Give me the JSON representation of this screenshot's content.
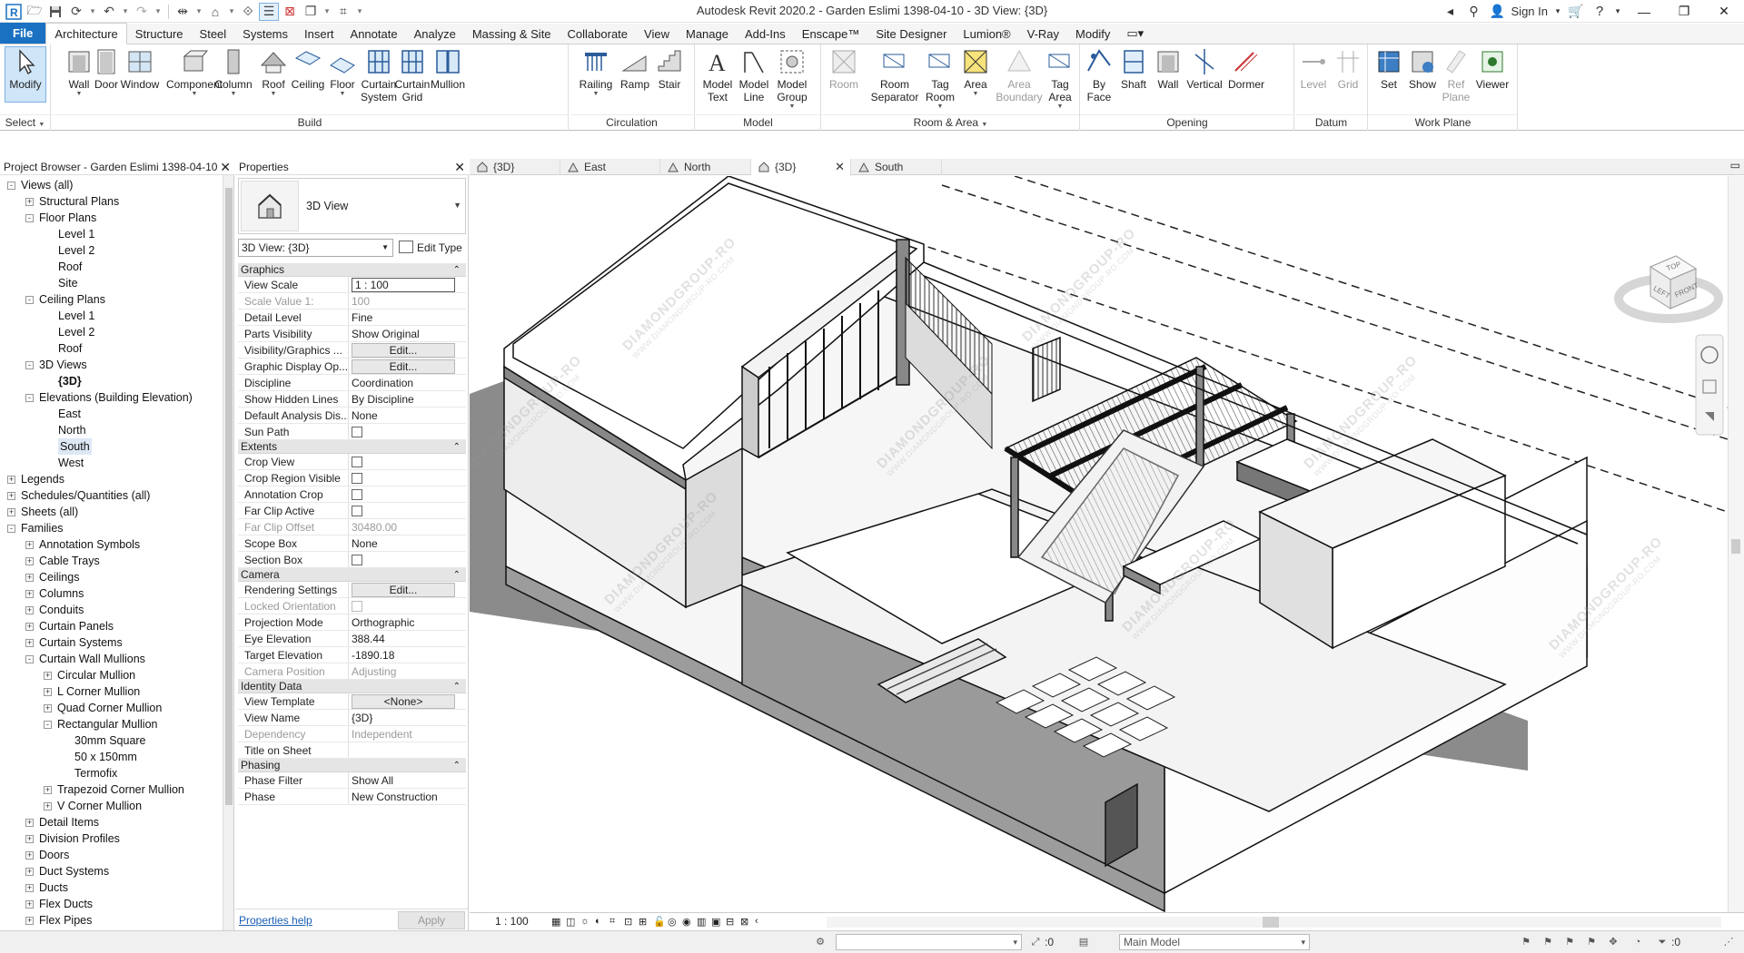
{
  "window": {
    "title": "Autodesk Revit 2020.2 - Garden Eslimi 1398-04-10 - 3D View: {3D}",
    "sign_in": "Sign In"
  },
  "ribbon_tabs": [
    {
      "label": "File",
      "kind": "file"
    },
    {
      "label": "Architecture",
      "kind": "active"
    },
    {
      "label": "Structure"
    },
    {
      "label": "Steel"
    },
    {
      "label": "Systems"
    },
    {
      "label": "Insert"
    },
    {
      "label": "Annotate"
    },
    {
      "label": "Analyze"
    },
    {
      "label": "Massing & Site"
    },
    {
      "label": "Collaborate"
    },
    {
      "label": "View"
    },
    {
      "label": "Manage"
    },
    {
      "label": "Add-Ins"
    },
    {
      "label": "Enscape™"
    },
    {
      "label": "Site Designer"
    },
    {
      "label": "Lumion®"
    },
    {
      "label": "V-Ray"
    },
    {
      "label": "Modify"
    }
  ],
  "ribbon_groups": {
    "select": {
      "label": "Select",
      "buttons": [
        {
          "label": "Modify"
        }
      ]
    },
    "build": {
      "label": "Build",
      "buttons": [
        {
          "label": "Wall"
        },
        {
          "label": "Door"
        },
        {
          "label": "Window"
        },
        {
          "label": "Component"
        },
        {
          "label": "Column"
        },
        {
          "label": "Roof"
        },
        {
          "label": "Ceiling"
        },
        {
          "label": "Floor"
        },
        {
          "label": "Curtain\nSystem"
        },
        {
          "label": "Curtain\nGrid"
        },
        {
          "label": "Mullion"
        }
      ]
    },
    "circulation": {
      "label": "Circulation",
      "buttons": [
        {
          "label": "Railing"
        },
        {
          "label": "Ramp"
        },
        {
          "label": "Stair"
        }
      ]
    },
    "model": {
      "label": "Model",
      "buttons": [
        {
          "label": "Model\nText"
        },
        {
          "label": "Model\nLine"
        },
        {
          "label": "Model\nGroup"
        }
      ]
    },
    "room_area": {
      "label": "Room & Area",
      "buttons": [
        {
          "label": "Room"
        },
        {
          "label": "Room\nSeparator"
        },
        {
          "label": "Tag\nRoom"
        },
        {
          "label": "Area"
        },
        {
          "label": "Area\nBoundary"
        },
        {
          "label": "Tag\nArea"
        }
      ]
    },
    "opening": {
      "label": "Opening",
      "buttons": [
        {
          "label": "By\nFace"
        },
        {
          "label": "Shaft"
        },
        {
          "label": "Wall"
        },
        {
          "label": "Vertical"
        },
        {
          "label": "Dormer"
        }
      ]
    },
    "datum": {
      "label": "Datum",
      "buttons": [
        {
          "label": "Level"
        },
        {
          "label": "Grid"
        }
      ]
    },
    "work_plane": {
      "label": "Work Plane",
      "buttons": [
        {
          "label": "Set"
        },
        {
          "label": "Show"
        },
        {
          "label": "Ref\nPlane"
        },
        {
          "label": "Viewer"
        }
      ]
    }
  },
  "project_browser": {
    "title": "Project Browser - Garden Eslimi 1398-04-10",
    "items": [
      {
        "label": "Views (all)",
        "level": 0,
        "toggle": "-"
      },
      {
        "label": "Structural Plans",
        "level": 1,
        "toggle": "+"
      },
      {
        "label": "Floor Plans",
        "level": 1,
        "toggle": "-"
      },
      {
        "label": "Level 1",
        "level": 2
      },
      {
        "label": "Level 2",
        "level": 2
      },
      {
        "label": "Roof",
        "level": 2
      },
      {
        "label": "Site",
        "level": 2
      },
      {
        "label": "Ceiling Plans",
        "level": 1,
        "toggle": "-"
      },
      {
        "label": "Level 1",
        "level": 2
      },
      {
        "label": "Level 2",
        "level": 2
      },
      {
        "label": "Roof",
        "level": 2
      },
      {
        "label": "3D Views",
        "level": 1,
        "toggle": "-"
      },
      {
        "label": "{3D}",
        "level": 2,
        "bold": true
      },
      {
        "label": "Elevations (Building Elevation)",
        "level": 1,
        "toggle": "-"
      },
      {
        "label": "East",
        "level": 2
      },
      {
        "label": "North",
        "level": 2
      },
      {
        "label": "South",
        "level": 2,
        "selected": true
      },
      {
        "label": "West",
        "level": 2
      },
      {
        "label": "Legends",
        "level": 0,
        "toggle": "+"
      },
      {
        "label": "Schedules/Quantities (all)",
        "level": 0,
        "toggle": "+"
      },
      {
        "label": "Sheets (all)",
        "level": 0,
        "toggle": "+"
      },
      {
        "label": "Families",
        "level": 0,
        "toggle": "-"
      },
      {
        "label": "Annotation Symbols",
        "level": 1,
        "toggle": "+"
      },
      {
        "label": "Cable Trays",
        "level": 1,
        "toggle": "+"
      },
      {
        "label": "Ceilings",
        "level": 1,
        "toggle": "+"
      },
      {
        "label": "Columns",
        "level": 1,
        "toggle": "+"
      },
      {
        "label": "Conduits",
        "level": 1,
        "toggle": "+"
      },
      {
        "label": "Curtain Panels",
        "level": 1,
        "toggle": "+"
      },
      {
        "label": "Curtain Systems",
        "level": 1,
        "toggle": "+"
      },
      {
        "label": "Curtain Wall Mullions",
        "level": 1,
        "toggle": "-"
      },
      {
        "label": "Circular Mullion",
        "level": 2,
        "toggle": "+"
      },
      {
        "label": "L Corner Mullion",
        "level": 2,
        "toggle": "+"
      },
      {
        "label": "Quad Corner Mullion",
        "level": 2,
        "toggle": "+"
      },
      {
        "label": "Rectangular Mullion",
        "level": 2,
        "toggle": "-"
      },
      {
        "label": "30mm Square",
        "level": 3
      },
      {
        "label": "50 x 150mm",
        "level": 3
      },
      {
        "label": "Termofix",
        "level": 3
      },
      {
        "label": "Trapezoid Corner Mullion",
        "level": 2,
        "toggle": "+"
      },
      {
        "label": "V Corner Mullion",
        "level": 2,
        "toggle": "+"
      },
      {
        "label": "Detail Items",
        "level": 1,
        "toggle": "+"
      },
      {
        "label": "Division Profiles",
        "level": 1,
        "toggle": "+"
      },
      {
        "label": "Doors",
        "level": 1,
        "toggle": "+"
      },
      {
        "label": "Duct Systems",
        "level": 1,
        "toggle": "+"
      },
      {
        "label": "Ducts",
        "level": 1,
        "toggle": "+"
      },
      {
        "label": "Flex Ducts",
        "level": 1,
        "toggle": "+"
      },
      {
        "label": "Flex Pipes",
        "level": 1,
        "toggle": "+"
      }
    ]
  },
  "properties": {
    "title": "Properties",
    "type_name": "3D View",
    "instance_selector": "3D View: {3D}",
    "edit_type": "Edit Type",
    "help_link": "Properties help",
    "apply": "Apply",
    "categories": [
      {
        "name": "Graphics",
        "rows": [
          {
            "name": "View Scale",
            "value": "1 : 100",
            "kind": "input"
          },
          {
            "name": "Scale Value    1:",
            "value": "100",
            "dim": true
          },
          {
            "name": "Detail Level",
            "value": "Fine"
          },
          {
            "name": "Parts Visibility",
            "value": "Show Original"
          },
          {
            "name": "Visibility/Graphics ...",
            "value": "Edit...",
            "kind": "button"
          },
          {
            "name": "Graphic Display Op...",
            "value": "Edit...",
            "kind": "button"
          },
          {
            "name": "Discipline",
            "value": "Coordination"
          },
          {
            "name": "Show Hidden Lines",
            "value": "By Discipline"
          },
          {
            "name": "Default Analysis Dis...",
            "value": "None"
          },
          {
            "name": "Sun Path",
            "value": "",
            "kind": "check"
          }
        ]
      },
      {
        "name": "Extents",
        "rows": [
          {
            "name": "Crop View",
            "value": "",
            "kind": "check"
          },
          {
            "name": "Crop Region Visible",
            "value": "",
            "kind": "check"
          },
          {
            "name": "Annotation Crop",
            "value": "",
            "kind": "check"
          },
          {
            "name": "Far Clip Active",
            "value": "",
            "kind": "check"
          },
          {
            "name": "Far Clip Offset",
            "value": "30480.00",
            "dim": true
          },
          {
            "name": "Scope Box",
            "value": "None"
          },
          {
            "name": "Section Box",
            "value": "",
            "kind": "check"
          }
        ]
      },
      {
        "name": "Camera",
        "rows": [
          {
            "name": "Rendering Settings",
            "value": "Edit...",
            "kind": "button"
          },
          {
            "name": "Locked Orientation",
            "value": "",
            "kind": "check",
            "dim": true
          },
          {
            "name": "Projection Mode",
            "value": "Orthographic"
          },
          {
            "name": "Eye Elevation",
            "value": "388.44"
          },
          {
            "name": "Target Elevation",
            "value": "-1890.18"
          },
          {
            "name": "Camera Position",
            "value": "Adjusting",
            "dim": true
          }
        ]
      },
      {
        "name": "Identity Data",
        "rows": [
          {
            "name": "View Template",
            "value": "<None>",
            "kind": "button"
          },
          {
            "name": "View Name",
            "value": "{3D}"
          },
          {
            "name": "Dependency",
            "value": "Independent",
            "dim": true
          },
          {
            "name": "Title on Sheet",
            "value": ""
          }
        ]
      },
      {
        "name": "Phasing",
        "rows": [
          {
            "name": "Phase Filter",
            "value": "Show All"
          },
          {
            "name": "Phase",
            "value": "New Construction"
          }
        ]
      }
    ]
  },
  "view_tabs": [
    {
      "label": "{3D}"
    },
    {
      "label": "East"
    },
    {
      "label": "North"
    },
    {
      "label": "{3D}",
      "active": true
    },
    {
      "label": "South"
    }
  ],
  "view_control_bar": {
    "scale": "1 : 100"
  },
  "viewcube": {
    "top": "TOP",
    "left": "LEFT",
    "front": "FRONT"
  },
  "watermark": {
    "name": "DIAMONDGROUP-RO",
    "url": "WWW.DIAMONDGROUP-RO.COM"
  },
  "status_bar": {
    "counter": ":0",
    "counter2": ":0",
    "model": "Main Model"
  },
  "colors": {
    "file_tab": "#1a71c2",
    "selection": "#cfe5f8",
    "accent": "#1a5fb4"
  }
}
